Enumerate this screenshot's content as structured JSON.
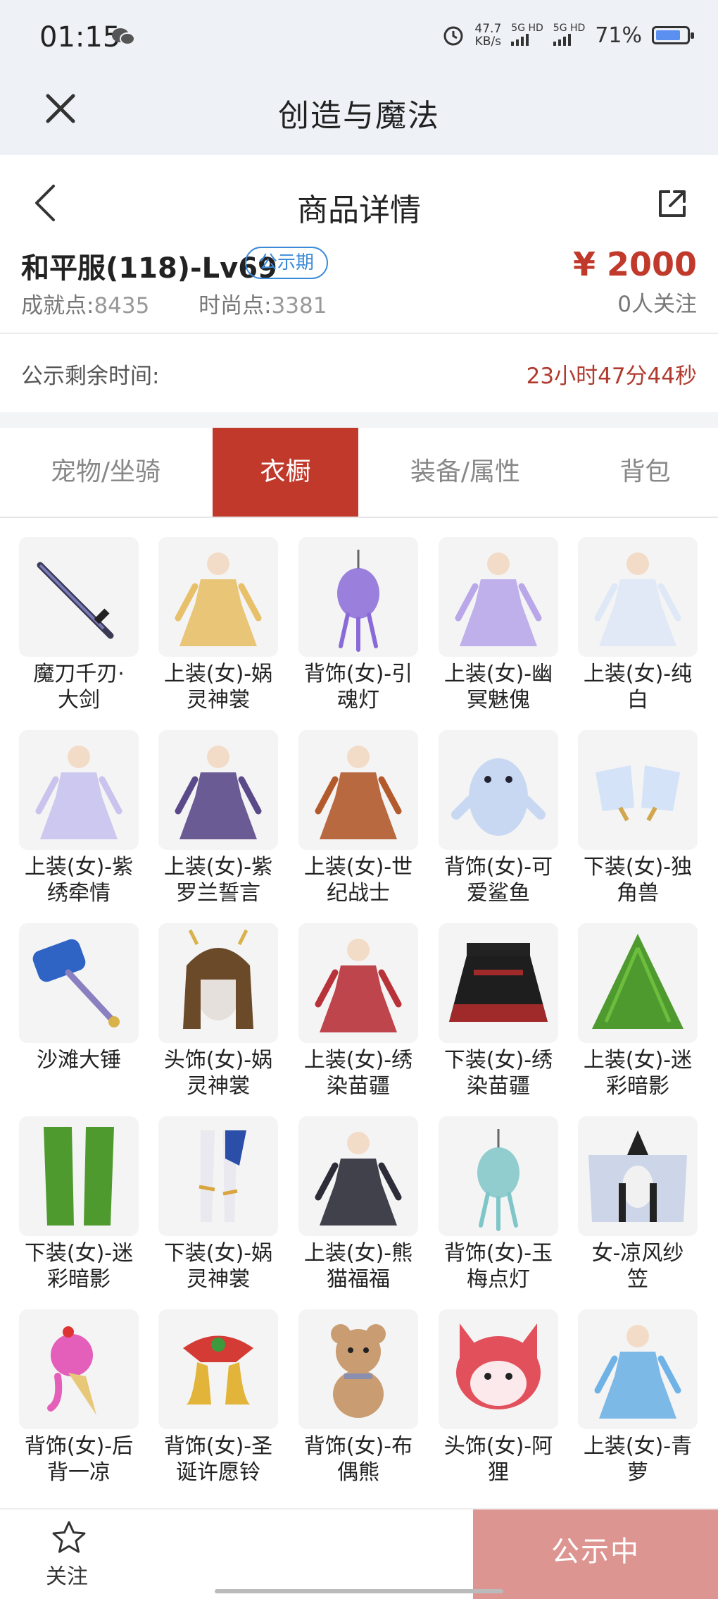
{
  "status_bar": {
    "time": "01:15",
    "speed_value": "47.7",
    "speed_unit": "KB/s",
    "sim1": "5G HD",
    "sim2": "5G HD",
    "battery": "71%"
  },
  "app_bar": {
    "title": "创造与魔法"
  },
  "detail_header": {
    "title": "商品详情"
  },
  "product": {
    "name": "和平服(118)-Lv69",
    "badge": "公示期",
    "price": "¥ 2000",
    "achievement_label": "成就点:",
    "achievement_value": "8435",
    "fashion_label": "时尚点:",
    "fashion_value": "3381",
    "followers": "0人关注"
  },
  "countdown": {
    "label": "公示剩余时间:",
    "value": "23小时47分44秒"
  },
  "tabs": [
    {
      "label": "宠物/坐骑",
      "active": false
    },
    {
      "label": "衣橱",
      "active": true
    },
    {
      "label": "装备/属性",
      "active": false
    },
    {
      "label": "背包",
      "active": false
    }
  ],
  "items": [
    {
      "name": "魔刀千刃·\n大剑",
      "icon": "sword-icon",
      "color": "#3a3a55"
    },
    {
      "name": "上装(女)-娲\n灵神裳",
      "icon": "dress-icon",
      "color": "#e8c06a"
    },
    {
      "name": "背饰(女)-引\n魂灯",
      "icon": "lantern-icon",
      "color": "#8a6ad8"
    },
    {
      "name": "上装(女)-幽\n冥魅傀",
      "icon": "dress-icon",
      "color": "#b9a7ea"
    },
    {
      "name": "上装(女)-纯\n白",
      "icon": "dress-icon",
      "color": "#dfe8f6"
    },
    {
      "name": "上装(女)-紫\n绣牵情",
      "icon": "dress-icon",
      "color": "#c9c3ee"
    },
    {
      "name": "上装(女)-紫\n罗兰誓言",
      "icon": "dress-icon",
      "color": "#5b4a8a"
    },
    {
      "name": "上装(女)-世\n纪战士",
      "icon": "dress-icon",
      "color": "#b35a2c"
    },
    {
      "name": "背饰(女)-可\n爱鲨鱼",
      "icon": "shark-icon",
      "color": "#c9d8f2"
    },
    {
      "name": "下装(女)-独\n角兽",
      "icon": "boots-icon",
      "color": "#d4e3f7"
    },
    {
      "name": "沙滩大锤",
      "icon": "hammer-icon",
      "color": "#2f63c4"
    },
    {
      "name": "头饰(女)-娲\n灵神裳",
      "icon": "headdress-icon",
      "color": "#6b4a2a"
    },
    {
      "name": "上装(女)-绣\n染苗疆",
      "icon": "dress-icon",
      "color": "#b8323a"
    },
    {
      "name": "下装(女)-绣\n染苗疆",
      "icon": "skirt-icon",
      "color": "#a02a2a"
    },
    {
      "name": "上装(女)-迷\n彩暗影",
      "icon": "leaf-icon",
      "color": "#4e9a2e"
    },
    {
      "name": "下装(女)-迷\n彩暗影",
      "icon": "pants-icon",
      "color": "#4e9a2e"
    },
    {
      "name": "下装(女)-娲\n灵神裳",
      "icon": "legs-icon",
      "color": "#c7d3ea"
    },
    {
      "name": "上装(女)-熊\n猫福福",
      "icon": "dress-icon",
      "color": "#2d2d3a"
    },
    {
      "name": "背饰(女)-玉\n梅点灯",
      "icon": "lantern-icon",
      "color": "#7fc6c8"
    },
    {
      "name": "女-凉风纱\n笠",
      "icon": "hat-icon",
      "color": "#c6d0e6"
    },
    {
      "name": "背饰(女)-后\n背一凉",
      "icon": "icecream-icon",
      "color": "#e35fb9"
    },
    {
      "name": "背饰(女)-圣\n诞许愿铃",
      "icon": "bell-icon",
      "color": "#d43b34"
    },
    {
      "name": "背饰(女)-布\n偶熊",
      "icon": "bear-icon",
      "color": "#c99c72"
    },
    {
      "name": "头饰(女)-阿\n狸",
      "icon": "fox-icon",
      "color": "#e2505c"
    },
    {
      "name": "上装(女)-青\n萝",
      "icon": "dress-icon",
      "color": "#6fb2e6"
    }
  ],
  "bottom_bar": {
    "follow_label": "关注",
    "action_label": "公示中"
  }
}
